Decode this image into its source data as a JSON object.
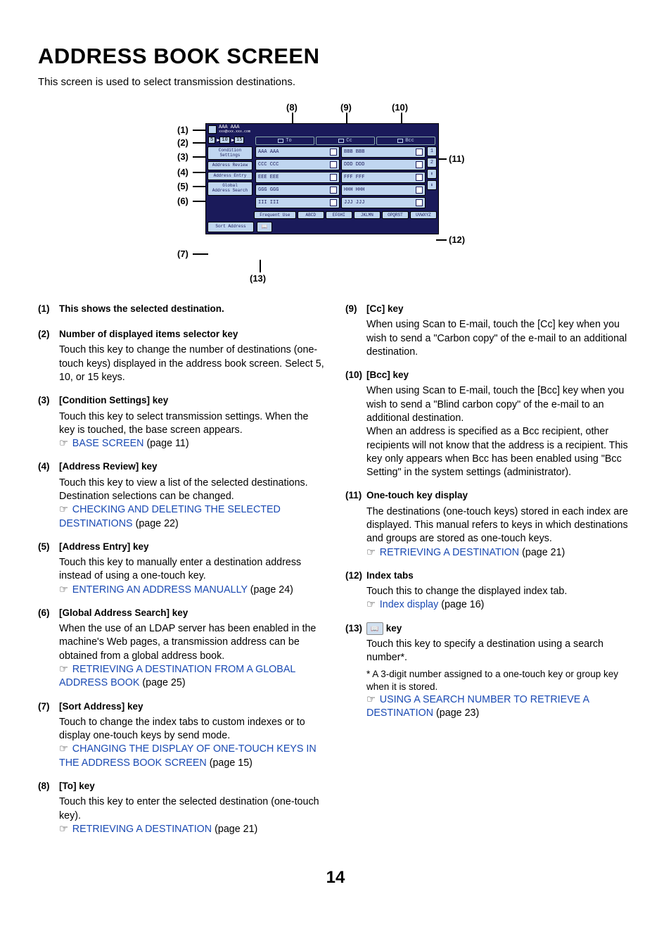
{
  "title": "ADDRESS BOOK SCREEN",
  "intro": "This screen is used to select transmission destinations.",
  "page_number": "14",
  "diagram": {
    "header_line1": "AAA AAA",
    "header_line2": "xxx@xxx.xxx.com",
    "row2_segments": [
      "5",
      "10",
      "15"
    ],
    "tabs": {
      "to": "To",
      "cc": "Cc",
      "bcc": "Bcc"
    },
    "side_buttons": {
      "condition": "Condition\nSettings",
      "review": "Address Review",
      "entry": "Address Entry",
      "global": "Global\nAddress Search",
      "sort": "Sort Address"
    },
    "search_key_icon": "📖",
    "cells": [
      [
        "AAA AAA",
        "BBB BBB"
      ],
      [
        "CCC CCC",
        "DDD DDD"
      ],
      [
        "EEE EEE",
        "FFF FFF"
      ],
      [
        "GGG GGG",
        "HHH HHH"
      ],
      [
        "III III",
        "JJJ JJJ"
      ]
    ],
    "scroll": {
      "p1": "1",
      "p2": "2",
      "up": "⬆",
      "down": "⬇"
    },
    "index_tabs": [
      "Frequent Use",
      "ABCD",
      "EFGHI",
      "JKLMN",
      "OPQRST",
      "UVWXYZ"
    ]
  },
  "callout_labels": {
    "c1": "(1)",
    "c2": "(2)",
    "c3": "(3)",
    "c4": "(4)",
    "c5": "(5)",
    "c6": "(6)",
    "c7": "(7)",
    "c8": "(8)",
    "c9": "(9)",
    "c10": "(10)",
    "c11": "(11)",
    "c12": "(12)",
    "c13": "(13)"
  },
  "left_col": [
    {
      "num": "(1)",
      "head": "This shows the selected destination."
    },
    {
      "num": "(2)",
      "head": "Number of displayed items selector key",
      "desc": "Touch this key to change the number of destinations (one-touch keys) displayed in the address book screen. Select 5, 10, or 15 keys."
    },
    {
      "num": "(3)",
      "head": "[Condition Settings] key",
      "desc": "Touch this key to select transmission settings. When the key is touched, the base screen appears.",
      "link": "BASE SCREEN",
      "link_page": "(page 11)"
    },
    {
      "num": "(4)",
      "head": "[Address Review] key",
      "desc": "Touch this key to view a list of the selected destinations. Destination selections can be changed.",
      "link": "CHECKING AND DELETING THE SELECTED DESTINATIONS",
      "link_page": "(page 22)"
    },
    {
      "num": "(5)",
      "head": "[Address Entry] key",
      "desc": "Touch this key to manually enter a destination address instead of using a one-touch key.",
      "link": "ENTERING AN ADDRESS MANUALLY",
      "link_page": "(page 24)"
    },
    {
      "num": "(6)",
      "head": "[Global Address Search] key",
      "desc": "When the use of an LDAP server has been enabled in the machine's Web pages, a transmission address can be obtained from a global address book.",
      "link": "RETRIEVING A DESTINATION FROM A GLOBAL ADDRESS BOOK",
      "link_page": "(page 25)"
    },
    {
      "num": "(7)",
      "head": "[Sort Address] key",
      "desc": "Touch to change the index tabs to custom indexes or to display one-touch keys by send mode.",
      "link": "CHANGING THE DISPLAY OF ONE-TOUCH KEYS IN THE ADDRESS BOOK SCREEN",
      "link_page": "(page 15)"
    },
    {
      "num": "(8)",
      "head": "[To] key",
      "desc": "Touch this key to enter the selected destination (one-touch key).",
      "link": "RETRIEVING A DESTINATION",
      "link_page": "(page 21)"
    }
  ],
  "right_col": [
    {
      "num": "(9)",
      "head": "[Cc] key",
      "desc": "When using Scan to E-mail, touch the [Cc] key when you wish to send a \"Carbon copy\" of the e-mail to an additional destination."
    },
    {
      "num": "(10)",
      "head": "[Bcc] key",
      "desc": "When using Scan to E-mail, touch the [Bcc] key when you wish to send a \"Blind carbon copy\" of the e-mail to an additional destination.\nWhen an address is specified as a Bcc recipient, other recipients will not know that the address is a recipient. This key only appears when Bcc has been enabled using \"Bcc Setting\" in the system settings (administrator)."
    },
    {
      "num": "(11)",
      "head": "One-touch key display",
      "desc": "The destinations (one-touch keys) stored in each index are displayed. This manual refers to keys in which destinations and groups are stored as one-touch keys.",
      "link": "RETRIEVING A DESTINATION",
      "link_page": "(page 21)"
    },
    {
      "num": "(12)",
      "head": "Index tabs",
      "desc": "Touch this to change the displayed index tab.",
      "link": "Index display",
      "link_page": "(page 16)"
    },
    {
      "num": "(13)",
      "head_suffix": " key",
      "desc": "Touch this key to specify a destination using a search number*.",
      "footnote": "* A 3-digit number assigned to a one-touch key or group key when it is stored.",
      "link": "USING A SEARCH NUMBER TO RETRIEVE A DESTINATION",
      "link_page": "(page 23)"
    }
  ]
}
